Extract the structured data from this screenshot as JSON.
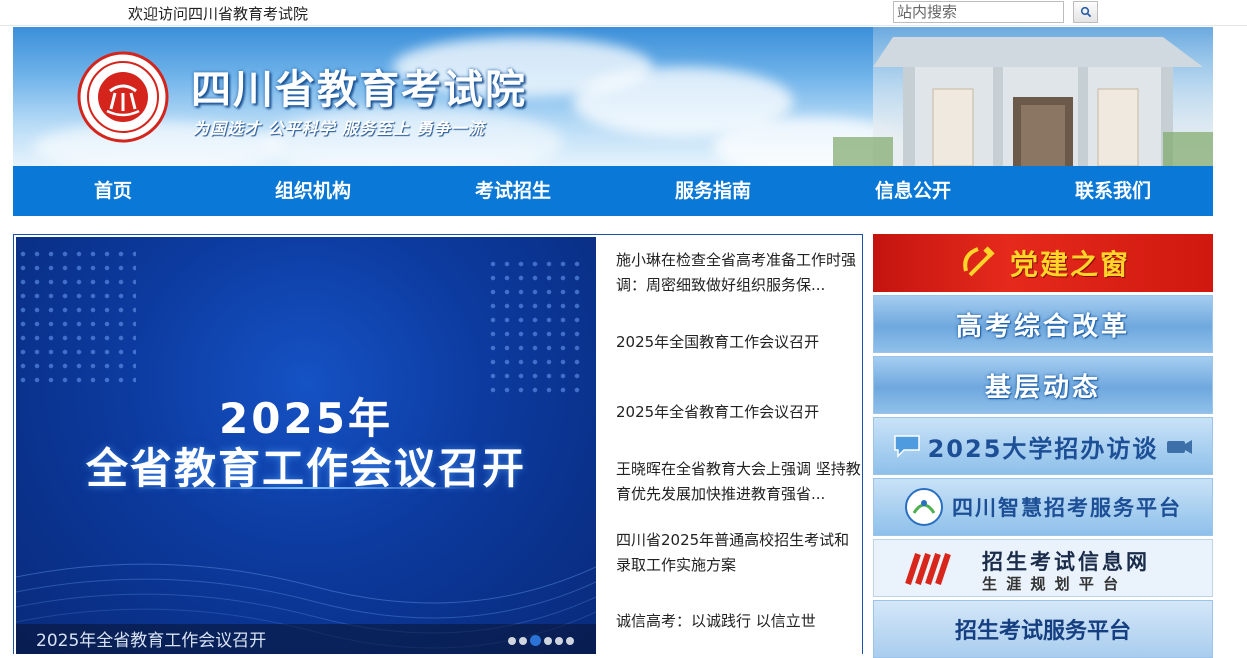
{
  "topbar": {
    "welcome": "欢迎访问四川省教育考试院",
    "search_placeholder": "站内搜索"
  },
  "header": {
    "title": "四川省教育考试院",
    "slogan": "为国选才  公平科学  服务至上  勇争一流"
  },
  "nav": {
    "items": [
      {
        "label": "首页"
      },
      {
        "label": "组织机构"
      },
      {
        "label": "考试招生"
      },
      {
        "label": "服务指南"
      },
      {
        "label": "信息公开"
      },
      {
        "label": "联系我们"
      }
    ]
  },
  "slider": {
    "year": "2025年",
    "headline": "全省教育工作会议召开",
    "caption": "2025年全省教育工作会议召开",
    "slide_count": 6,
    "active_slide": 3
  },
  "news": {
    "items": [
      {
        "title": "施小琳在检查全省高考准备工作时强调：周密细致做好组织服务保..."
      },
      {
        "title": "2025年全国教育工作会议召开"
      },
      {
        "title": "2025年全省教育工作会议召开"
      },
      {
        "title": "王晓晖在全省教育大会上强调 坚持教育优先发展加快推进教育强省..."
      },
      {
        "title": "四川省2025年普通高校招生考试和录取工作实施方案"
      },
      {
        "title": "诚信高考：以诚践行 以信立世"
      }
    ]
  },
  "sidebar": {
    "cards": [
      {
        "label": "党建之窗"
      },
      {
        "label": "高考综合改革"
      },
      {
        "label": "基层动态"
      },
      {
        "label": "2025大学招办访谈"
      },
      {
        "label": "四川智慧招考服务平台"
      },
      {
        "label": "招生考试信息网",
        "sub": "生 涯 规 划 平 台"
      },
      {
        "label": "招生考试服务平台"
      }
    ]
  },
  "colors": {
    "nav_blue": "#0a78d7",
    "party_red": "#d0180f",
    "slide_blue": "#0c3a9e"
  }
}
